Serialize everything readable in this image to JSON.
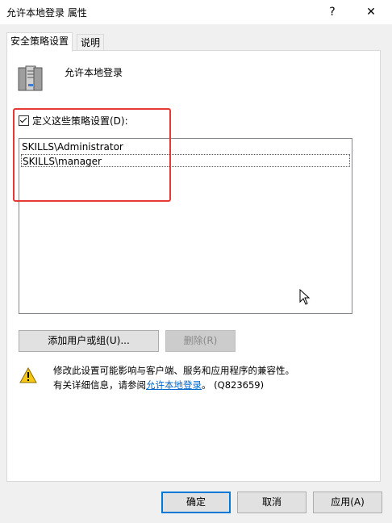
{
  "window": {
    "title": "允许本地登录 属性",
    "help_glyph": "?",
    "close_glyph": "✕"
  },
  "tabs": [
    {
      "label": "安全策略设置",
      "active": true
    },
    {
      "label": "说明",
      "active": false
    }
  ],
  "policy": {
    "name": "允许本地登录",
    "icon": "server-icon"
  },
  "define": {
    "checked": true,
    "label": "定义这些策略设置(D):"
  },
  "list": {
    "items": [
      "SKILLS\\Administrator",
      "SKILLS\\manager"
    ],
    "selected_index": 1
  },
  "actions": {
    "add_label": "添加用户或组(U)...",
    "remove_label": "删除(R)"
  },
  "warning": {
    "icon": "warning-icon",
    "line1": "修改此设置可能影响与客户端、服务和应用程序的兼容性。",
    "line2_prefix": "有关详细信息，请参阅",
    "link_text": "允许本地登录",
    "line2_suffix": "。 (Q823659)"
  },
  "footer": {
    "ok_label": "确定",
    "cancel_label": "取消",
    "apply_label": "应用(A)"
  },
  "colors": {
    "highlight_box": "#e53935",
    "link": "#0066cc",
    "primary_border": "#0078d7"
  }
}
